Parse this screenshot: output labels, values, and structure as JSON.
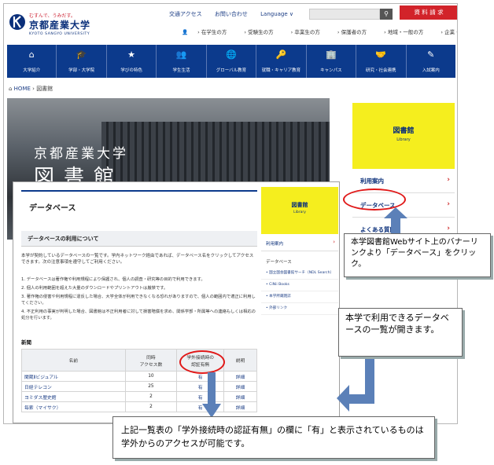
{
  "site": {
    "slogan": "むすんで、うみだす。",
    "name": "京都産業大学",
    "name_en": "KYOTO SANGYO UNIVERSITY",
    "top_links": [
      "交通アクセス",
      "お問い合わせ",
      "Language ∨"
    ],
    "request_button": "資 料 請 求",
    "audience_links": [
      "在学生の方",
      "受験生の方",
      "卒業生の方",
      "保護者の方",
      "地域・一般の方",
      "企業・教育関係の方"
    ],
    "global_nav": [
      {
        "label": "大学紹介",
        "icon": "⌂"
      },
      {
        "label": "学部・大学院",
        "icon": "🎓"
      },
      {
        "label": "学びの特色",
        "icon": "★"
      },
      {
        "label": "学生生活",
        "icon": "👥"
      },
      {
        "label": "グローバル教育",
        "icon": "🌐"
      },
      {
        "label": "就職・キャリア教育",
        "icon": "🔑"
      },
      {
        "label": "キャンパス",
        "icon": "🏢"
      },
      {
        "label": "研究・社会連携",
        "icon": "🤝"
      },
      {
        "label": "入試案内",
        "icon": "✎"
      }
    ],
    "breadcrumb": {
      "home": "HOME",
      "current": "図書館"
    },
    "hero": {
      "line1": "京都産業大学",
      "line2": "図書館"
    },
    "sidebar": {
      "title": "図書館",
      "subtitle": "Library",
      "items": [
        "利用案内",
        "データベース",
        "よくある質問"
      ]
    }
  },
  "db_page": {
    "title": "データベース",
    "usage_heading": "データベースの利用について",
    "intro": "本学が契約しているデータベースの一覧です。学内ネットワーク経由であれば、データベース名をクリックしてアクセスできます。次の注意事項を遵守してご利用ください。",
    "notes": [
      "1. データベースは著作権や利用規程により保護され、個人の調査・研究等の目的で利用できます。",
      "2. 個人の利用範囲を超えた大量のダウンロードやプリントアウトは厳禁です。",
      "3. 著作権の侵害や利用規程に違反した場合、大学全体が利用できなくなる恐れがありますので、個人の範囲内で適正に利用してください。",
      "4. 不正利用の事実が判明した場合、図書館は不正利用者に対して損害賠償を求め、関係学部・所属等への連絡もしくは相応の処分を行います。"
    ],
    "section": "新聞",
    "table": {
      "headers": [
        "名前",
        "同時\nアクセス数",
        "学外接続時の\n認証有無",
        "説明"
      ],
      "rows": [
        {
          "name": "聞蔵Ⅱビジュアル",
          "count": "10",
          "auth": "有",
          "desc": "詳細"
        },
        {
          "name": "日経テレコン",
          "count": "25",
          "auth": "有",
          "desc": "詳細"
        },
        {
          "name": "ヨミダス歴史館",
          "count": "2",
          "auth": "有",
          "desc": "詳細"
        },
        {
          "name": "毎索（マイサク）",
          "count": "2",
          "auth": "有",
          "desc": "詳細"
        }
      ]
    },
    "sidebar": {
      "title": "図書館",
      "subtitle": "Library",
      "guide": "利用案内",
      "db_label": "データベース",
      "sub_items": [
        "国立国会図書館サーチ（NDL Search）",
        "CiNii Books",
        "本学所蔵雑誌",
        "外部リンク"
      ]
    }
  },
  "callouts": {
    "c1": "本学図書館Webサイト上のバナーリンクより「データベース」をクリック。",
    "c2": "本学で利用できるデータベースの一覧が開きます。",
    "c3": "上記一覧表の「学外接続時の認証有無」の欄に「有」と表示されているものは学外からのアクセスが可能です。"
  },
  "colors": {
    "navy": "#0c3a8c",
    "yellow": "#f5ee1e",
    "red": "#e01818",
    "arrow": "#5b80b8"
  }
}
